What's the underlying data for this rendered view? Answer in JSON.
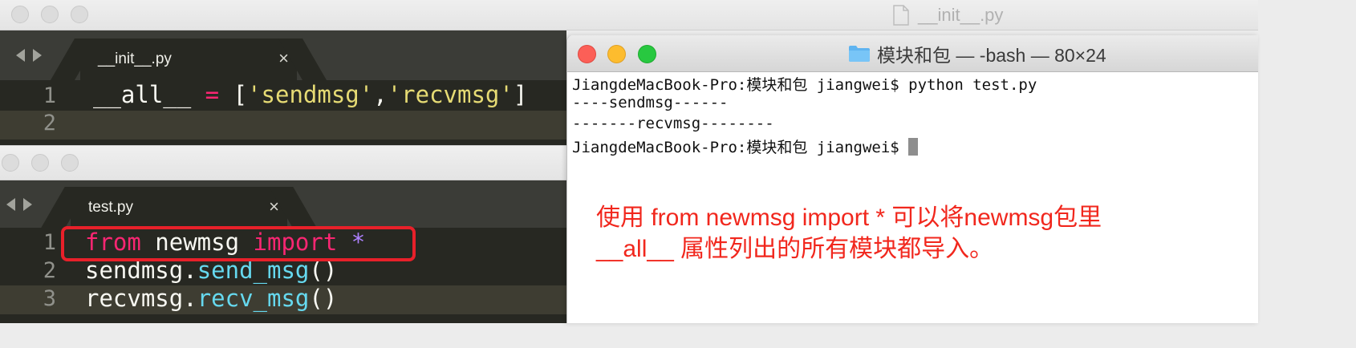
{
  "background_window": {
    "title": "__init__.py"
  },
  "editor_top": {
    "tab_label": "__init__.py",
    "close_glyph": "×",
    "lines": [
      {
        "number": "1",
        "parts": [
          "__all__",
          " = ",
          "[",
          "'sendmsg'",
          ",",
          "'recvmsg'",
          "]"
        ]
      },
      {
        "number": "2",
        "parts": []
      }
    ]
  },
  "editor_bottom": {
    "tab_label": "test.py",
    "close_glyph": "×",
    "lines": [
      {
        "number": "1",
        "kw1": "from",
        "mod": " newmsg ",
        "kw2": "import",
        "sp": " ",
        "star": "*"
      },
      {
        "number": "2",
        "obj": "sendmsg",
        "dot": ".",
        "fn": "send_msg",
        "paren": "()"
      },
      {
        "number": "3",
        "obj": "recvmsg",
        "dot": ".",
        "fn": "recv_msg",
        "paren": "()"
      }
    ]
  },
  "terminal": {
    "title": "模块和包 — -bash — 80×24",
    "lines": [
      "JiangdeMacBook-Pro:模块和包 jiangwei$ python test.py",
      "----sendmsg------",
      "-------recvmsg--------",
      "JiangdeMacBook-Pro:模块和包 jiangwei$ "
    ]
  },
  "annotation": {
    "line1": "使用 from newmsg import * 可以将newmsg包里",
    "line2": "__all__ 属性列出的所有模块都导入。"
  },
  "colors": {
    "editor_bg": "#272822",
    "keyword": "#f92672",
    "string": "#e6db74",
    "function": "#66d9ef",
    "number_literal": "#ae81ff",
    "annotation_red": "#f1271d"
  }
}
